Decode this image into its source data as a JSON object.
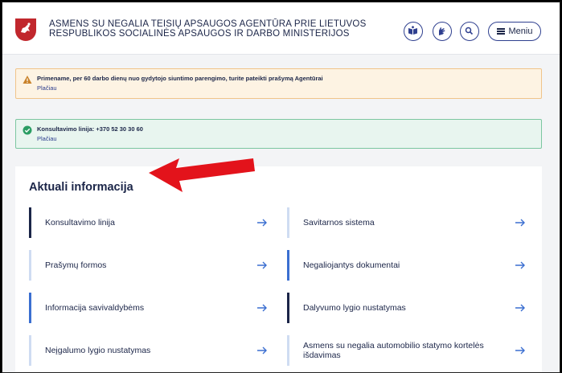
{
  "header": {
    "agency_line1": "ASMENS SU NEGALIA TEISIŲ APSAUGOS AGENTŪRA PRIE LIETUVOS",
    "agency_line2": "RESPUBLIKOS SOCIALINĖS APSAUGOS IR DARBO MINISTERIJOS",
    "menu_label": "Meniu",
    "icons": [
      "coat-of-arms-icon",
      "easy-read-icon",
      "sign-language-icon",
      "search-icon",
      "menu-icon"
    ]
  },
  "alerts": [
    {
      "type": "warning",
      "text": "Primename, per 60 darbo dienų nuo gydytojo siuntimo parengimo, turite pateikti prašymą Agentūrai",
      "more": "Plačiau"
    },
    {
      "type": "success",
      "text": "Konsultavimo linija: +370 52 30 30 60",
      "more": "Plačiau"
    }
  ],
  "section": {
    "title": "Aktuali informacija",
    "links": [
      {
        "label": "Konsultavimo linija",
        "accent": "#1b2548"
      },
      {
        "label": "Savitarnos sistema",
        "accent": "#cfdcf2"
      },
      {
        "label": "Prašymų formos",
        "accent": "#cfdcf2"
      },
      {
        "label": "Negaliojantys dokumentai",
        "accent": "#3b6fd1"
      },
      {
        "label": "Informacija savivaldybėms",
        "accent": "#3b6fd1"
      },
      {
        "label": "Dalyvumo lygio nustatymas",
        "accent": "#1b2548"
      },
      {
        "label": "Neįgalumo lygio nustatymas",
        "accent": "#cfdcf2"
      },
      {
        "label": "Asmens su negalia automobilio statymo kortelės išdavimas",
        "accent": "#cfdcf2"
      }
    ]
  },
  "colors": {
    "annotation_arrow": "#e3131b",
    "link_arrow": "#3b6fd1"
  }
}
